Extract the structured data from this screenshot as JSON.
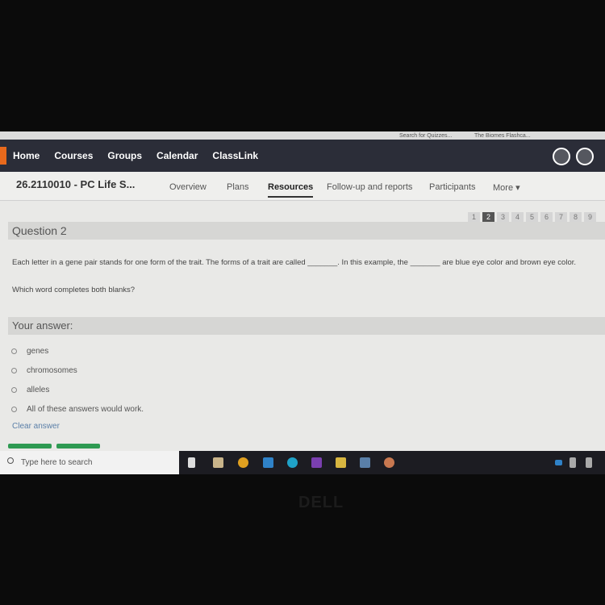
{
  "browser": {
    "bookmarks": [
      "Search for Quizzes...",
      "The Biomes Flashca..."
    ]
  },
  "topnav": {
    "items": [
      "Home",
      "Courses",
      "Groups",
      "Calendar",
      "ClassLink"
    ]
  },
  "course": {
    "title": "26.2110010 - PC Life S...",
    "tabs": [
      "Overview",
      "Plans",
      "Resources",
      "Follow-up and reports",
      "Participants",
      "More ▾"
    ],
    "active_tab": "Resources"
  },
  "pager": {
    "pages": [
      "1",
      "2",
      "3",
      "4",
      "5",
      "6",
      "7",
      "8",
      "9"
    ],
    "current": "2"
  },
  "question": {
    "heading": "Question 2",
    "text": "Each letter in a gene pair stands for one form of the trait. The forms of a trait are called _______. In this example, the _______ are blue eye color and brown eye color.",
    "prompt": "Which word completes both blanks?"
  },
  "answer": {
    "heading": "Your answer:",
    "options": [
      "genes",
      "chromosomes",
      "alleles",
      "All of these answers would work."
    ],
    "clear": "Clear answer"
  },
  "taskbar": {
    "search_placeholder": "Type here to search"
  },
  "brand": "DELL",
  "colors": {
    "accent": "#e8691c",
    "nav_bg": "#2b2d38",
    "button": "#2e9a52"
  }
}
